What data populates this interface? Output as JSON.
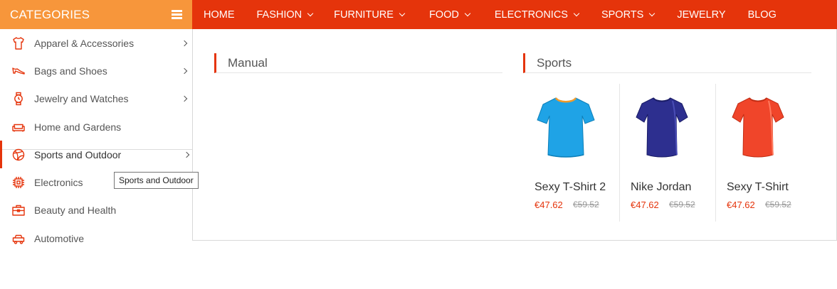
{
  "header": {
    "categories_title": "CATEGORIES"
  },
  "topnav": [
    {
      "label": "HOME",
      "dropdown": false
    },
    {
      "label": "FASHION",
      "dropdown": true
    },
    {
      "label": "FURNITURE",
      "dropdown": true
    },
    {
      "label": "FOOD",
      "dropdown": true
    },
    {
      "label": "ELECTRONICS",
      "dropdown": true
    },
    {
      "label": "SPORTS",
      "dropdown": true
    },
    {
      "label": "JEWELRY",
      "dropdown": false
    },
    {
      "label": "BLOG",
      "dropdown": false
    }
  ],
  "sidebar": {
    "items": [
      {
        "label": "Apparel & Accessories",
        "icon": "tshirt-icon",
        "has_submenu": true
      },
      {
        "label": "Bags and Shoes",
        "icon": "shoe-icon",
        "has_submenu": true
      },
      {
        "label": "Jewelry and Watches",
        "icon": "watch-icon",
        "has_submenu": true
      },
      {
        "label": "Home and Gardens",
        "icon": "sofa-icon",
        "has_submenu": false
      },
      {
        "label": "Sports and Outdoor",
        "icon": "ball-icon",
        "has_submenu": true,
        "active": true
      },
      {
        "label": "Electronics",
        "icon": "chip-icon",
        "has_submenu": false
      },
      {
        "label": "Beauty and Health",
        "icon": "briefcase-icon",
        "has_submenu": false
      },
      {
        "label": "Automotive",
        "icon": "car-icon",
        "has_submenu": false
      }
    ]
  },
  "tooltip": {
    "text": "Sports and Outdoor"
  },
  "mega": {
    "manual_title": "Manual",
    "sports_title": "Sports",
    "products": [
      {
        "name": "Sexy T-Shirt 2",
        "price": "€47.62",
        "old_price": "€59.52",
        "color": "#1fa3e6",
        "image": "tshirt-blue-image"
      },
      {
        "name": "Nike Jordan",
        "price": "€47.62",
        "old_price": "€59.52",
        "color": "#2d2f8f",
        "image": "tshirt-navy-image"
      },
      {
        "name": "Sexy T-Shirt",
        "price": "€47.62",
        "old_price": "€59.52",
        "color": "#f0452a",
        "image": "tshirt-red-image"
      }
    ]
  },
  "colors": {
    "accent": "#e5340b",
    "categories_bg": "#f7963b"
  }
}
